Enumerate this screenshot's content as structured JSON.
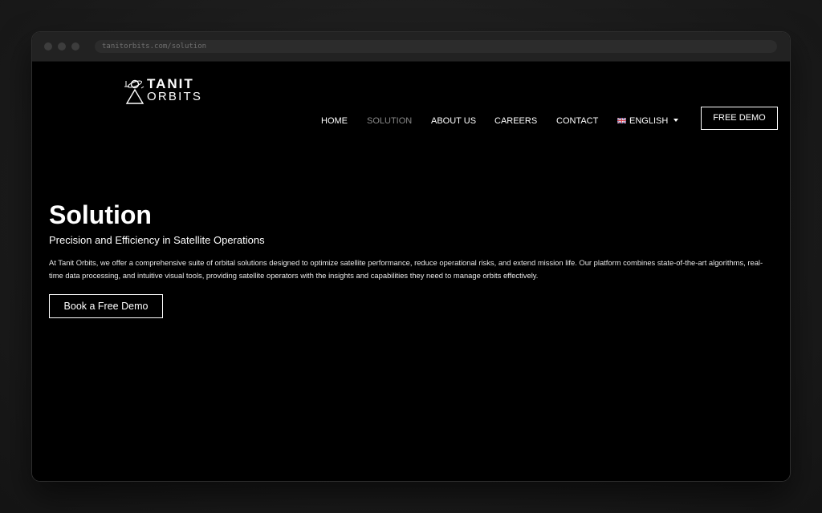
{
  "browser": {
    "url": "tanitorbits.com/solution"
  },
  "logo": {
    "word1": "TANIT",
    "word2": "ORBITS"
  },
  "nav": {
    "home": "HOME",
    "solution": "SOLUTION",
    "about": "ABOUT US",
    "careers": "CAREERS",
    "contact": "CONTACT",
    "language": "ENGLISH",
    "demo_button": "FREE DEMO"
  },
  "hero": {
    "title": "Solution",
    "subtitle": "Precision and Efficiency in Satellite Operations",
    "body": "At Tanit Orbits, we offer a comprehensive suite of orbital solutions designed to optimize satellite performance, reduce operational risks, and extend mission life. Our platform combines state-of-the-art algorithms, real-time data processing, and intuitive visual tools, providing satellite operators with the insights and capabilities they need to manage orbits effectively.",
    "cta": "Book a Free Demo"
  },
  "icons": {
    "logo_mark": "satellite-triangle-icon",
    "language_flag": "uk-flag-icon",
    "dropdown": "caret-down-icon"
  },
  "colors": {
    "page_background": "#000000",
    "text": "#ffffff",
    "active_nav": "#8a8a8a"
  }
}
